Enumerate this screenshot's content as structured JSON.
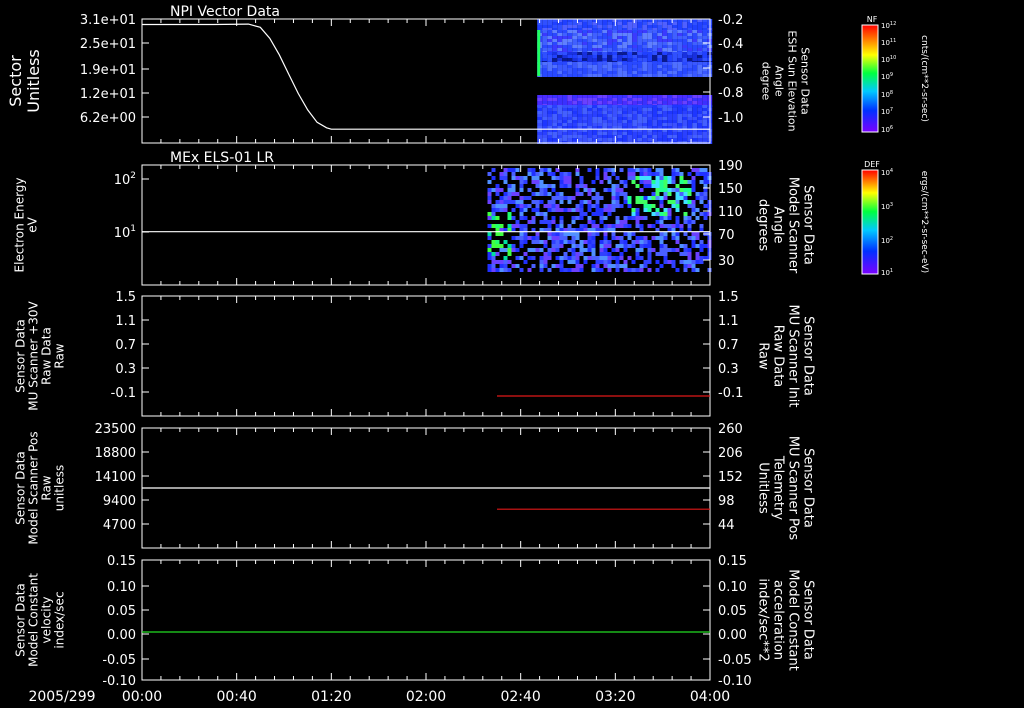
{
  "date_label": "2005/299",
  "time_ticks": [
    "00:00",
    "00:40",
    "01:20",
    "02:00",
    "02:40",
    "03:20",
    "04:00"
  ],
  "colors": {
    "white": "#ffffff",
    "red": "#e01818",
    "green": "#22dd22",
    "background": "#000000"
  },
  "colorbars": [
    {
      "label": "NF",
      "units": "cnts/(cm**2-sr-sec)",
      "ticks": [
        "10^12",
        "10^11",
        "10^10",
        "10^9",
        "10^8",
        "10^7",
        "10^6"
      ]
    },
    {
      "label": "DEF",
      "units": "ergs/(cm**2-sr-sec-eV)",
      "ticks": [
        "10^4",
        "10^3",
        "10^2",
        "10^1"
      ]
    }
  ],
  "chart_data": [
    {
      "type": "heatmap",
      "title": "NPI Vector Data",
      "ylabel": [
        "Sector",
        "Unitless"
      ],
      "yticks": [
        "3.1e+01",
        "2.5e+01",
        "1.9e+01",
        "1.2e+01",
        "6.2e+00"
      ],
      "ylim": [
        0,
        31
      ],
      "y2label": [
        "Sensor Data",
        "ESH Sun Elevation",
        "Angle",
        "degree"
      ],
      "y2ticks": [
        "-0.2",
        "-0.4",
        "-0.6",
        "-0.8",
        "-1.0"
      ],
      "y2lim": [
        -1.1,
        -0.2
      ],
      "xlim_min": [
        0,
        240
      ],
      "heatmap_extent_min": [
        167,
        240
      ],
      "series": [
        {
          "name": "ESH Sun Elevation Angle",
          "color": "white",
          "axis": "right",
          "x": [
            0,
            30,
            45,
            50,
            54,
            58,
            62,
            66,
            70,
            74,
            78,
            80,
            85,
            120,
            167,
            240
          ],
          "values": [
            -0.24,
            -0.24,
            -0.237,
            -0.26,
            -0.34,
            -0.46,
            -0.6,
            -0.74,
            -0.86,
            -0.95,
            -0.99,
            -1.0,
            -1.0,
            -1.0,
            -1.0,
            -1.0
          ]
        }
      ]
    },
    {
      "type": "heatmap",
      "title": "MEx ELS-01 LR",
      "ylabel": [
        "Electron Energy",
        "eV"
      ],
      "yticks": [
        "10^2",
        "10^1"
      ],
      "ylim_log": [
        1,
        200
      ],
      "y2label": [
        "Sensor Data",
        "Model Scanner",
        "Angle",
        "degrees"
      ],
      "y2ticks": [
        "190",
        "150",
        "110",
        "70",
        "30"
      ],
      "y2lim": [
        10,
        190
      ],
      "xlim_min": [
        0,
        240
      ],
      "heatmap_extent_min": [
        146,
        240
      ],
      "series": [
        {
          "name": "Model Scanner Angle",
          "color": "white",
          "axis": "right",
          "x": [
            0,
            240
          ],
          "values": [
            90,
            90
          ]
        }
      ]
    },
    {
      "type": "line",
      "ylabel": [
        "Sensor Data",
        "MU Scanner +30V",
        "Raw Data",
        "Raw"
      ],
      "yticks": [
        "1.5",
        "1.1",
        "0.7",
        "0.3",
        "-0.1"
      ],
      "ylim": [
        -0.3,
        1.5
      ],
      "y2label": [
        "Sensor Data",
        "MU Scanner Init",
        "Raw Data",
        "Raw"
      ],
      "y2ticks": [
        "1.5",
        "1.1",
        "0.7",
        "0.3",
        "-0.1"
      ],
      "y2lim": [
        -0.3,
        1.5
      ],
      "xlim_min": [
        0,
        240
      ],
      "series": [
        {
          "name": "MU Scanner Init",
          "color": "red",
          "axis": "right",
          "x": [
            150,
            240
          ],
          "values": [
            0.0,
            0.0
          ]
        }
      ]
    },
    {
      "type": "line",
      "ylabel": [
        "Sensor Data",
        "Model Scanner Pos",
        "Raw",
        "unitless"
      ],
      "yticks": [
        "23500",
        "18800",
        "14100",
        "9400",
        "4700"
      ],
      "ylim": [
        0,
        23500
      ],
      "y2label": [
        "Sensor Data",
        "MU Scanner Pos",
        "Telemetry",
        "Unitless"
      ],
      "y2ticks": [
        "260",
        "206",
        "152",
        "98",
        "44"
      ],
      "y2lim": [
        0,
        260
      ],
      "xlim_min": [
        0,
        240
      ],
      "series": [
        {
          "name": "Model Scanner Pos",
          "color": "white",
          "axis": "left",
          "x": [
            0,
            240
          ],
          "values": [
            11750,
            11750
          ]
        },
        {
          "name": "MU Scanner Pos Telemetry",
          "color": "red",
          "axis": "right",
          "x": [
            150,
            240
          ],
          "values": [
            84,
            84
          ]
        }
      ]
    },
    {
      "type": "line",
      "ylabel": [
        "Sensor Data",
        "Model Constant",
        "velocity",
        "index/sec"
      ],
      "yticks": [
        "0.15",
        "0.10",
        "0.05",
        "0.00",
        "-0.05",
        "-0.10"
      ],
      "ylim": [
        -0.1,
        0.15
      ],
      "y2label": [
        "Sensor Data",
        "Model Constant",
        "acceleration",
        "index/sec**2"
      ],
      "y2ticks": [
        "0.15",
        "0.10",
        "0.05",
        "0.00",
        "-0.05",
        "-0.10"
      ],
      "y2lim": [
        -0.1,
        0.15
      ],
      "xlim_min": [
        0,
        240
      ],
      "series": [
        {
          "name": "Model Constant acceleration",
          "color": "green",
          "axis": "right",
          "x": [
            0,
            240
          ],
          "values": [
            0,
            0
          ]
        }
      ]
    }
  ]
}
